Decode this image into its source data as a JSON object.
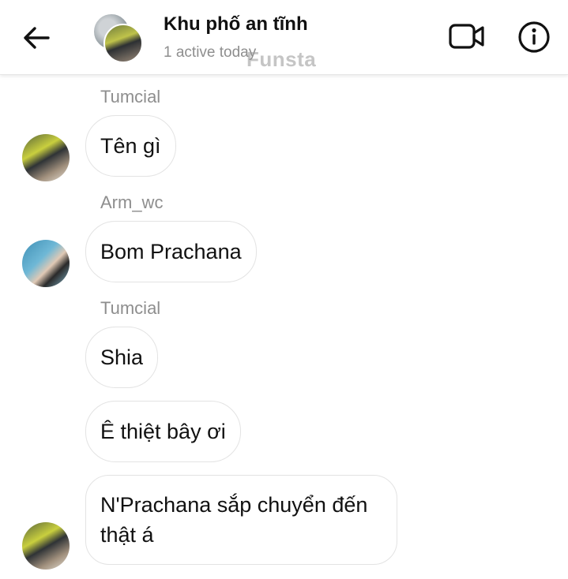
{
  "header": {
    "back_icon": "arrow-left-icon",
    "title": "Khu phố an tĩnh",
    "status": "1 active today",
    "watermark": "Funsta",
    "video_icon": "video-camera-icon",
    "info_icon": "info-icon"
  },
  "messages": [
    {
      "sender": "Tumcial",
      "text": "Tên gì"
    },
    {
      "sender": "Arm_wc",
      "text": "Bom Prachana"
    },
    {
      "sender": "Tumcial",
      "text": "Shia"
    },
    {
      "sender": "",
      "text": "Ê thiệt bây ơi"
    },
    {
      "sender": "",
      "text": "N'Prachana sắp chuyển đến thật á"
    }
  ],
  "colors": {
    "accent": "#111111",
    "muted": "#8e8e8e",
    "bubble_border": "#e3e3e3"
  }
}
